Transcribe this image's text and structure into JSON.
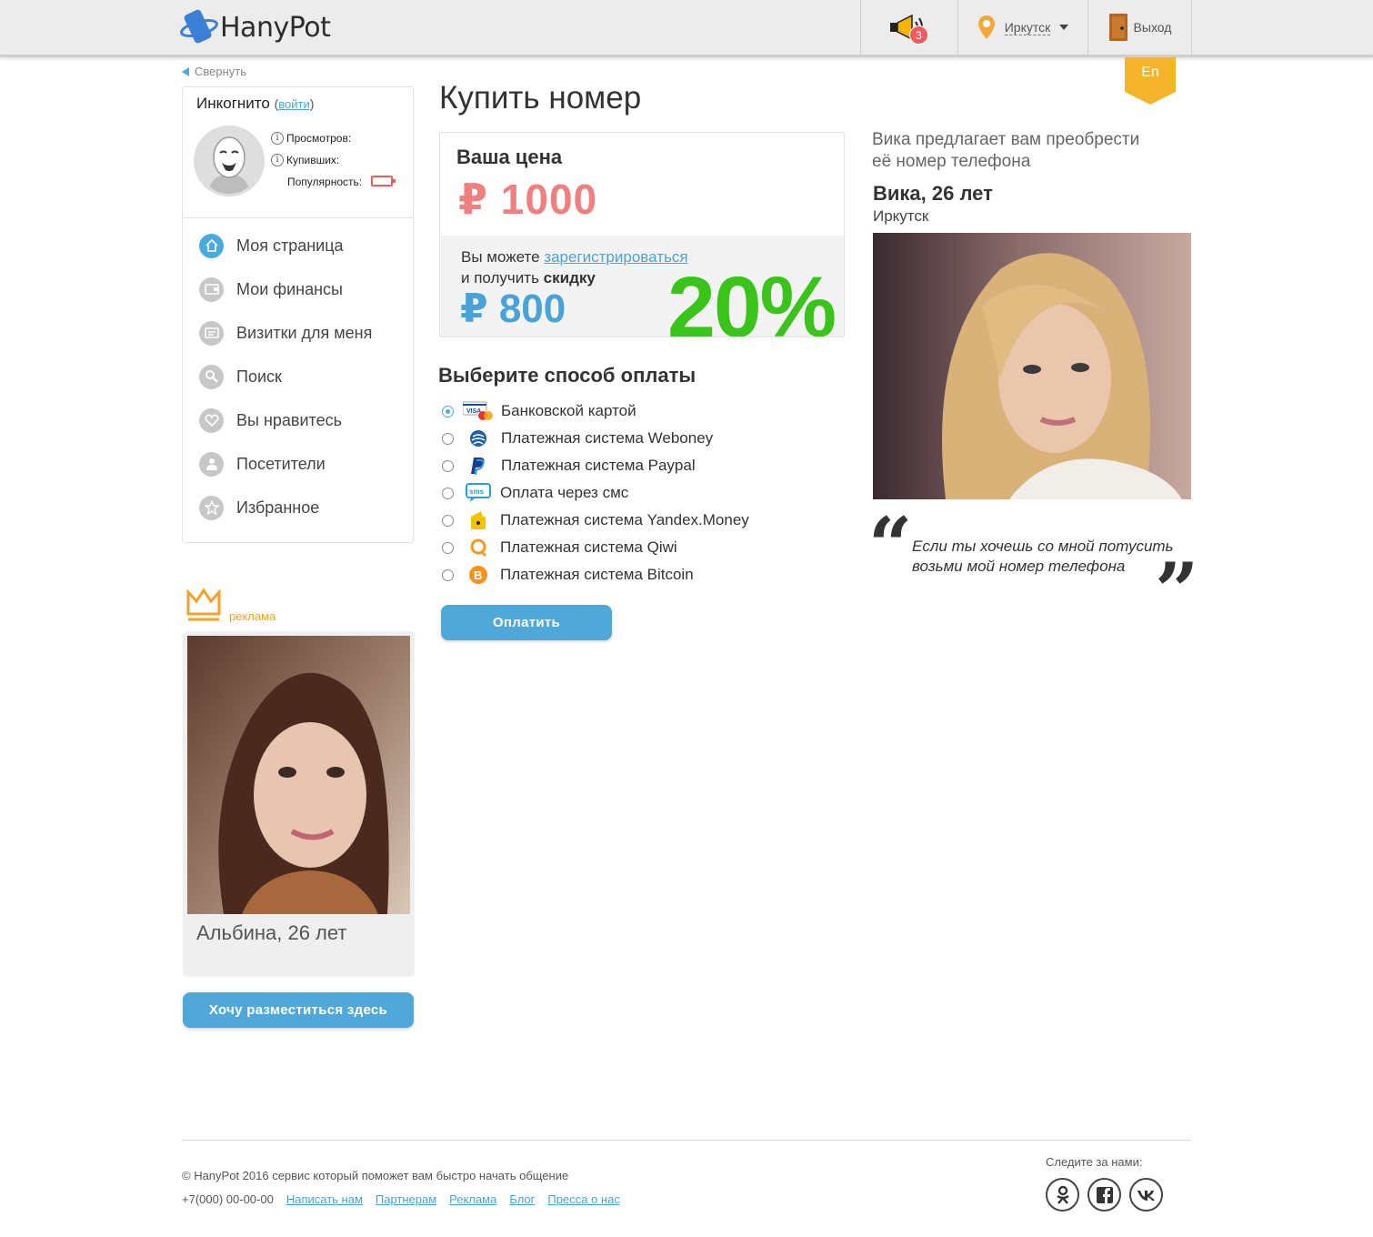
{
  "header": {
    "logo_text": "HanyPot",
    "notifications_count": "3",
    "city": "Иркутск",
    "logout_label": "Выход",
    "lang_label": "En"
  },
  "sidebar": {
    "collapse_label": "Свернуть",
    "profile": {
      "name": "Инкогнито",
      "login_link": "войти",
      "views_label": "Просмотров:",
      "buyers_label": "Купивших:",
      "popularity_label": "Популярность:"
    },
    "menu": [
      {
        "label": "Моя страница",
        "icon": "home-icon"
      },
      {
        "label": "Мои финансы",
        "icon": "wallet-icon"
      },
      {
        "label": "Визитки для меня",
        "icon": "card-icon"
      },
      {
        "label": "Поиск",
        "icon": "search-icon"
      },
      {
        "label": "Вы нравитесь",
        "icon": "heart-icon"
      },
      {
        "label": "Посетители",
        "icon": "user-icon"
      },
      {
        "label": "Избранное",
        "icon": "star-icon"
      }
    ],
    "ad": {
      "label": "реклама",
      "name": "Альбина, 26 лет",
      "button_label": "Хочу разместиться здесь"
    }
  },
  "main": {
    "title": "Купить номер",
    "price": {
      "label": "Ваша цена",
      "value": "₽ 1000",
      "discount_line1_prefix": "Вы можете ",
      "discount_register_link": "зарегистрироваться",
      "discount_line2_prefix": "и получить ",
      "discount_line2_bold": "скидку",
      "discounted_value": "₽ 800",
      "discount_percent": "20%"
    },
    "payment": {
      "title": "Выберите способ оплаты",
      "methods": [
        {
          "label": "Банковской картой",
          "icon": "visa-mastercard-icon",
          "checked": true
        },
        {
          "label": "Платежная система Weboney",
          "icon": "webmoney-icon",
          "checked": false
        },
        {
          "label": "Платежная система Paypal",
          "icon": "paypal-icon",
          "checked": false
        },
        {
          "label": "Оплата через смс",
          "icon": "sms-icon",
          "checked": false
        },
        {
          "label": "Платежная система Yandex.Money",
          "icon": "yandex-money-icon",
          "checked": false
        },
        {
          "label": "Платежная система Qiwi",
          "icon": "qiwi-icon",
          "checked": false
        },
        {
          "label": "Платежная система Bitcoin",
          "icon": "bitcoin-icon",
          "checked": false
        }
      ],
      "pay_button": "Оплатить"
    }
  },
  "offer": {
    "text": "Вика предлагает вам преобрести её номер телефона",
    "name": "Вика, 26 лет",
    "city": "Иркутск",
    "quote": "Если ты хочешь со мной потусить возьми мой номер телефона"
  },
  "footer": {
    "copyright": "© HanyPot 2016 сервис который поможет вам быстро начать общение",
    "phone": "+7(000) 00-00-00",
    "links": [
      "Написать нам",
      "Партнерам",
      "Реклама",
      "Блог",
      "Пресса о нас"
    ],
    "follow_label": "Следите за нами:",
    "socials": [
      "odnoklassniki-icon",
      "facebook-icon",
      "vk-icon"
    ]
  },
  "colors": {
    "accent_blue": "#4fa8d8",
    "price_red": "#f07f80",
    "discount_green": "#3ac31b",
    "badge_red": "#f15b5b",
    "ad_orange": "#f0a22a"
  }
}
